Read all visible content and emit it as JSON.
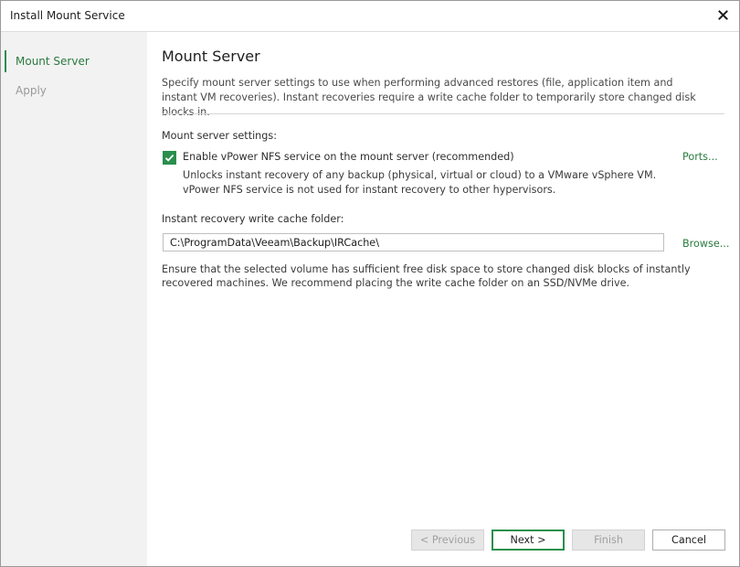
{
  "window": {
    "title": "Install Mount Service",
    "close_icon": "close-icon"
  },
  "sidebar": {
    "items": [
      {
        "label": "Mount Server",
        "state": "active"
      },
      {
        "label": "Apply",
        "state": "inactive"
      }
    ]
  },
  "main": {
    "title": "Mount Server",
    "description": "Specify mount server settings to use when performing advanced restores (file, application item and instant VM recoveries). Instant recoveries require a write cache folder to temporarily store changed disk blocks in.",
    "settings_label": "Mount server settings:",
    "nfs_checkbox": {
      "label": "Enable vPower NFS service on the mount server (recommended)",
      "checked": true
    },
    "ports_link": "Ports...",
    "nfs_hint_line1": "Unlocks instant recovery of any backup (physical, virtual or cloud) to a VMware vSphere VM.",
    "nfs_hint_line2": "vPower NFS service is not used for instant recovery to other hypervisors.",
    "cache_folder_label": "Instant recovery write cache folder:",
    "cache_folder_value": "C:\\ProgramData\\Veeam\\Backup\\IRCache\\",
    "browse_link": "Browse...",
    "warning": "Ensure that the selected volume has sufficient free disk space to store changed disk blocks of instantly recovered machines. We recommend placing the write cache folder on an SSD/NVMe drive."
  },
  "footer": {
    "previous_label": "< Previous",
    "next_label": "Next >",
    "finish_label": "Finish",
    "cancel_label": "Cancel"
  },
  "colors": {
    "accent": "#2a8f4c",
    "link": "#2a7a3e",
    "sidebar_bg": "#f2f2f2"
  }
}
